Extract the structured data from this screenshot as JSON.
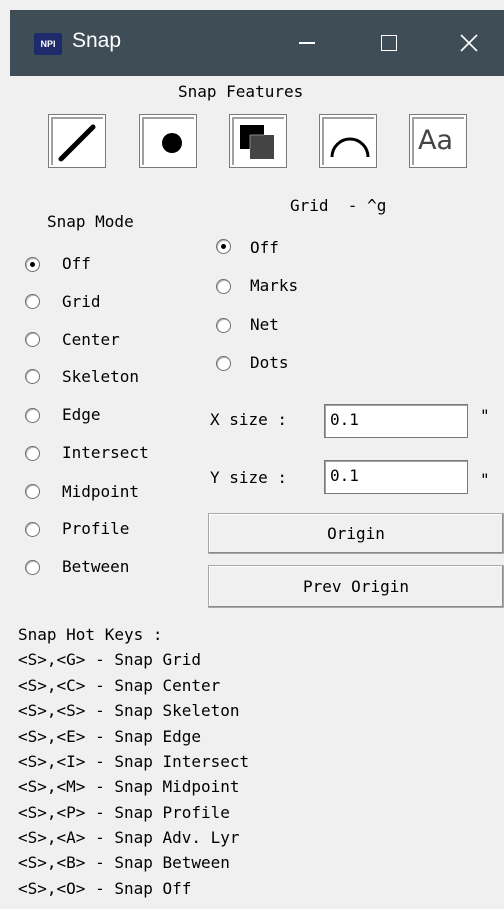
{
  "window": {
    "title": "Snap",
    "icon_label": "NPI"
  },
  "features": {
    "heading": "Snap Features",
    "buttons": [
      "line-tool",
      "dot-tool",
      "overlap-tool",
      "arc-tool",
      "text-tool"
    ],
    "text_button_label": "Aa"
  },
  "snap_mode": {
    "heading": "Snap Mode",
    "selected": "Off",
    "options": [
      "Off",
      "Grid",
      "Center",
      "Skeleton",
      "Edge",
      "Intersect",
      "Midpoint",
      "Profile",
      "Between"
    ]
  },
  "grid": {
    "heading": "Grid  - ^g",
    "selected": "Off",
    "options": [
      "Off",
      "Marks",
      "Net",
      "Dots"
    ],
    "x_label": "X size :",
    "x_value": "0.1",
    "y_label": "Y size :",
    "y_value": "0.1",
    "unit": "\"",
    "origin_label": "Origin",
    "prev_origin_label": "Prev Origin"
  },
  "hotkeys": {
    "heading": "Snap Hot Keys :",
    "lines": [
      "<S>,<G> - Snap Grid",
      "<S>,<C> - Snap Center",
      "<S>,<S> - Snap Skeleton",
      "<S>,<E> - Snap Edge",
      "<S>,<I> - Snap Intersect",
      "<S>,<M> - Snap Midpoint",
      "<S>,<P> - Snap Profile",
      "<S>,<A> - Snap Adv. Lyr",
      "<S>,<B> - Snap Between",
      "<S>,<O> - Snap Off"
    ]
  },
  "colors": {
    "titlebar": "#3e4d56",
    "dialog_bg": "#f0f0f0"
  }
}
